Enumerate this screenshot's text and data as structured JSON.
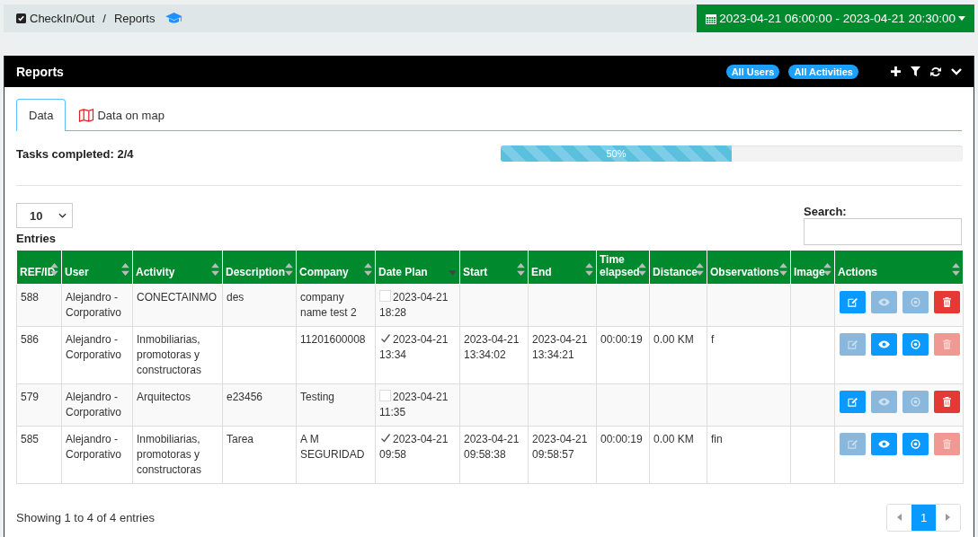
{
  "breadcrumb": {
    "items": [
      "CheckIn/Out",
      "Reports"
    ],
    "separator": "/"
  },
  "date_range": "2023-04-21 06:00:00 - 2023-04-21 20:30:00",
  "panel": {
    "title": "Reports",
    "filters": [
      "All Users",
      "All Activities"
    ]
  },
  "tabs": [
    {
      "label": "Data",
      "selected": true,
      "kind": "plain"
    },
    {
      "label": "Data on map",
      "selected": false,
      "kind": "map"
    }
  ],
  "progress": {
    "label": "Tasks completed: 2/4",
    "level": 0.5,
    "text": "50%"
  },
  "entries": {
    "value": "10",
    "label": "Entries"
  },
  "search": {
    "label": "Search:"
  },
  "table": {
    "columns": [
      {
        "label": "REF/ID",
        "sorted": false
      },
      {
        "label": "User",
        "sorted": false
      },
      {
        "label": "Activity",
        "sorted": false
      },
      {
        "label": "Description",
        "sorted": false
      },
      {
        "label": "Company",
        "sorted": false
      },
      {
        "label": "Date Plan",
        "sorted": true
      },
      {
        "label": "Start",
        "sorted": false
      },
      {
        "label": "End",
        "sorted": false
      },
      {
        "label": "Time elapsed",
        "sorted": false
      },
      {
        "label": "Distance",
        "sorted": false
      },
      {
        "label": "Observations",
        "sorted": false
      },
      {
        "label": "Image",
        "sorted": false
      },
      {
        "label": "Actions",
        "sorted": false
      }
    ],
    "rows": [
      {
        "id": "588",
        "user": "Alejandro - Corporativo",
        "activity": "CONECTAINMO",
        "description": "des",
        "company": "company name test 2",
        "date_plan": "2023-04-21 18:28",
        "done": false,
        "start": "",
        "end": "",
        "elapsed": "",
        "distance": "",
        "observations": "",
        "actions": [
          {
            "kind": "edit",
            "disabled": false
          },
          {
            "kind": "view",
            "disabled": true
          },
          {
            "kind": "locate",
            "disabled": true
          },
          {
            "kind": "delete",
            "disabled": false
          }
        ]
      },
      {
        "id": "586",
        "user": "Alejandro - Corporativo",
        "activity": "Inmobiliarias, promotoras y constructoras",
        "description": "",
        "company": "11201600008",
        "date_plan": "2023-04-21 13:34",
        "done": true,
        "start": "2023-04-21 13:34:02",
        "end": "2023-04-21 13:34:21",
        "elapsed": "00:00:19",
        "distance": "0.00 KM",
        "observations": "f",
        "actions": [
          {
            "kind": "edit",
            "disabled": true
          },
          {
            "kind": "view",
            "disabled": false
          },
          {
            "kind": "locate",
            "disabled": false
          },
          {
            "kind": "delete",
            "disabled": true
          }
        ]
      },
      {
        "id": "579",
        "user": "Alejandro - Corporativo",
        "activity": "Arquitectos",
        "description": "e23456",
        "company": "Testing",
        "date_plan": "2023-04-21 11:35",
        "done": false,
        "start": "",
        "end": "",
        "elapsed": "",
        "distance": "",
        "observations": "",
        "actions": [
          {
            "kind": "edit",
            "disabled": false
          },
          {
            "kind": "view",
            "disabled": true
          },
          {
            "kind": "locate",
            "disabled": true
          },
          {
            "kind": "delete",
            "disabled": false
          }
        ]
      },
      {
        "id": "585",
        "user": "Alejandro - Corporativo",
        "activity": "Inmobiliarias, promotoras y constructoras",
        "description": "Tarea",
        "company": "A M SEGURIDAD",
        "date_plan": "2023-04-21 09:58",
        "done": true,
        "start": "2023-04-21 09:58:38",
        "end": "2023-04-21 09:58:57",
        "elapsed": "00:00:19",
        "distance": "0.00 KM",
        "observations": "fin",
        "actions": [
          {
            "kind": "edit",
            "disabled": true
          },
          {
            "kind": "view",
            "disabled": false
          },
          {
            "kind": "locate",
            "disabled": false
          },
          {
            "kind": "delete",
            "disabled": true
          }
        ]
      }
    ]
  },
  "footer": {
    "info": "Showing 1 to 4 of 4 entries",
    "pages": [
      {
        "label": "1",
        "selected": true
      }
    ]
  }
}
